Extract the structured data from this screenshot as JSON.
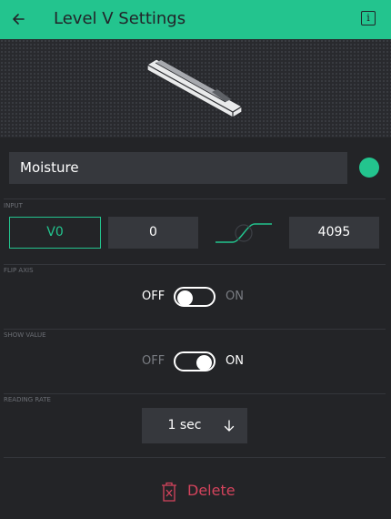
{
  "header": {
    "title": "Level V Settings",
    "back_icon": "arrow-left-icon",
    "info_icon": "info-icon",
    "info_glyph": "i"
  },
  "colors": {
    "accent": "#23c48e",
    "background": "#232427",
    "field": "#36383d",
    "delete": "#d3435c"
  },
  "widget": {
    "name": "Moisture",
    "color": "#23c48e",
    "preview_icon": "level-vertical-widget-icon"
  },
  "input": {
    "label": "INPUT",
    "pin": "V0",
    "min": "0",
    "max": "4095",
    "curve_icon": "mapping-curve-icon"
  },
  "flip_axis": {
    "label": "FLIP AXIS",
    "off": "OFF",
    "on": "ON",
    "enabled": false
  },
  "show_value": {
    "label": "SHOW VALUE",
    "off": "OFF",
    "on": "ON",
    "enabled": true
  },
  "reading_rate": {
    "label": "READING RATE",
    "value": "1 sec",
    "icon": "arrow-down-icon"
  },
  "delete": {
    "label": "Delete",
    "icon": "trash-icon"
  }
}
